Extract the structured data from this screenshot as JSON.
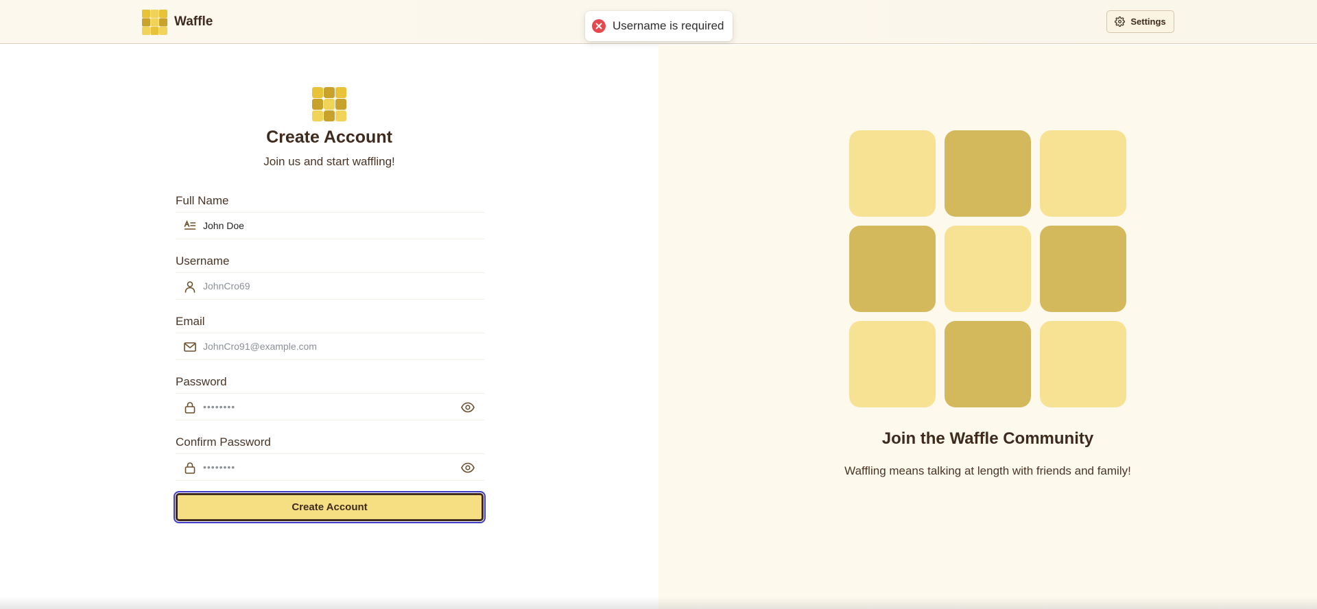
{
  "header": {
    "brand_name": "Waffle",
    "settings_label": "Settings"
  },
  "toast": {
    "message": "Username is required"
  },
  "form": {
    "title": "Create Account",
    "subtitle": "Join us and start waffling!",
    "fields": {
      "full_name": {
        "label": "Full Name",
        "value": "John Doe",
        "placeholder": ""
      },
      "username": {
        "label": "Username",
        "value": "",
        "placeholder": "JohnCro69"
      },
      "email": {
        "label": "Email",
        "value": "",
        "placeholder": "JohnCro91@example.com"
      },
      "password": {
        "label": "Password",
        "value": "",
        "placeholder": "••••••••"
      },
      "confirm_password": {
        "label": "Confirm Password",
        "value": "",
        "placeholder": "••••••••"
      }
    },
    "submit_label": "Create Account"
  },
  "promo": {
    "title": "Join the Waffle Community",
    "subtitle": "Waffling means talking at length with friends and family!",
    "grid_pattern": [
      "light",
      "dark",
      "light",
      "dark",
      "light",
      "dark",
      "light",
      "dark",
      "light"
    ]
  },
  "colors": {
    "accent": "#f6df82",
    "waffle_light": "#f7e294",
    "waffle_dark": "#d3b95c",
    "text_brown": "#3f2a1e",
    "error_red": "#e5484d",
    "focus_ring": "#3c38c8"
  },
  "icons": {
    "brand": "waffle-logo-icon",
    "settings": "gear-icon",
    "toast": "error-circle-icon",
    "full_name": "text-lines-icon",
    "username": "user-icon",
    "email": "mail-icon",
    "password": "lock-icon",
    "show_password": "eye-icon"
  }
}
